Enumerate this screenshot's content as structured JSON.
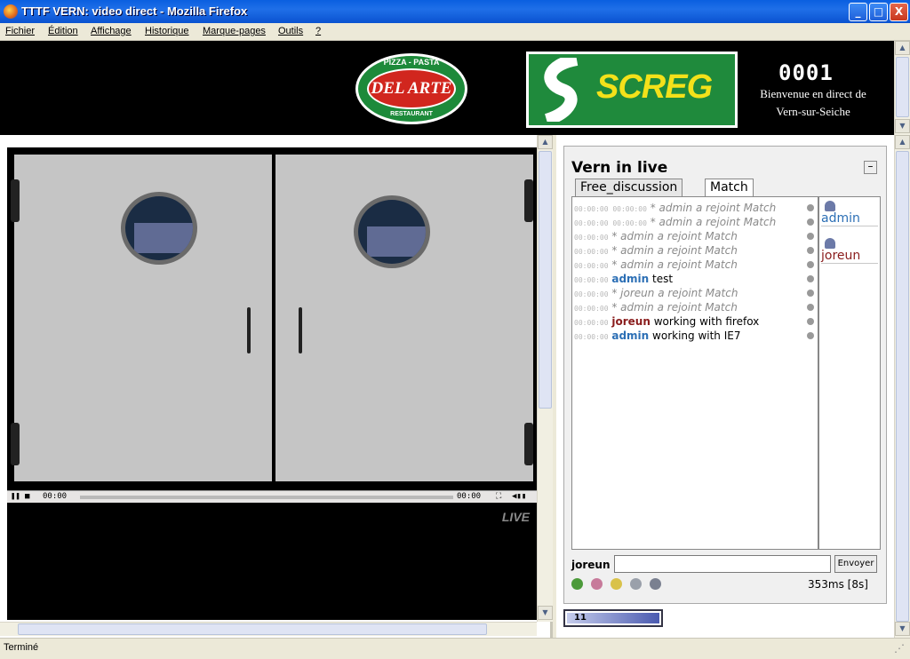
{
  "window": {
    "title": "TTTF VERN: video direct - Mozilla Firefox",
    "minimize": "_",
    "maximize": "□",
    "close": "X"
  },
  "menu": [
    "Fichier",
    "Édition",
    "Affichage",
    "Historique",
    "Marque-pages",
    "Outils",
    "?"
  ],
  "banner": {
    "pizza_top": "PIZZA - PASTA",
    "pizza_brand": "DEL ARTE",
    "pizza_bottom": "RESTAURANT",
    "screg": "SCREG",
    "counter": "0001",
    "welcome_line1": "Bienvenue en direct de",
    "welcome_line2": "Vern-sur-Seiche"
  },
  "player": {
    "time_current": "00:00",
    "time_total": "00:00",
    "live_label": "LIVE"
  },
  "chat": {
    "title": "Vern in live",
    "minimize_symbol": "–",
    "tabs": [
      {
        "label": "Free_discussion",
        "active": false
      },
      {
        "label": "Match",
        "active": true
      }
    ],
    "messages": [
      {
        "time": "00:00:00 00:00:00",
        "type": "system",
        "text": "* admin a rejoint Match"
      },
      {
        "time": "00:00:00 00:00:00",
        "type": "system",
        "text": "* admin a rejoint Match"
      },
      {
        "time": "00:00:00",
        "type": "system",
        "text": "* admin a rejoint Match"
      },
      {
        "time": "00:00:00",
        "type": "system",
        "text": "* admin a rejoint Match"
      },
      {
        "time": "00:00:00",
        "type": "system",
        "text": "* admin a rejoint Match"
      },
      {
        "time": "00:00:00",
        "type": "message",
        "user": "admin",
        "text": "test"
      },
      {
        "time": "00:00:00",
        "type": "system",
        "text": "* joreun a rejoint Match"
      },
      {
        "time": "00:00:00",
        "type": "system",
        "text": "* admin a rejoint Match"
      },
      {
        "time": "00:00:00",
        "type": "message",
        "user": "joreun",
        "text": "working with firefox"
      },
      {
        "time": "00:00:00",
        "type": "message",
        "user": "admin",
        "text": "working with IE7"
      }
    ],
    "users": [
      {
        "name": "admin"
      },
      {
        "name": "joreun"
      }
    ],
    "nick": "joreun",
    "input_value": "",
    "send_label": "Envoyer",
    "latency": "353ms [8s]",
    "bottom_value": "11"
  },
  "status": {
    "text": "Terminé"
  },
  "colors": {
    "admin": "#2c6fb5",
    "joreun": "#8a1c1c",
    "screg_green": "#1f8a3c",
    "screg_yellow": "#f3e11a"
  }
}
